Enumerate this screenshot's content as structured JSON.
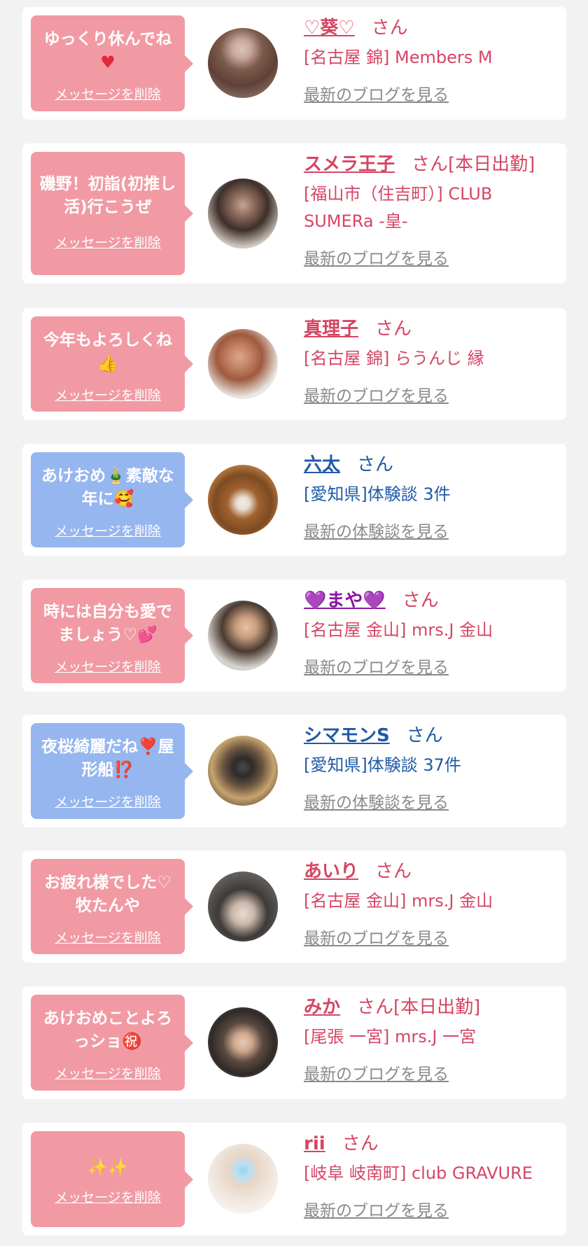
{
  "cards": [
    {
      "message": "ゆっくり休んでね",
      "message_emoji": "♥",
      "delete_label": "メッセージを削除",
      "name": "♡葵♡",
      "honorific": "さん",
      "shop": "[名古屋 錦] Members M",
      "link_label": "最新のブログを見る"
    },
    {
      "message": "磯野！初詣(初推し活)行こうぜ",
      "delete_label": "メッセージを削除",
      "name": "スメラ王子",
      "honorific": "さん[本日出勤]",
      "shop": "[福山市（住吉町）] CLUB SUMERa -皇-",
      "link_label": "最新のブログを見る"
    },
    {
      "message": "今年もよろしくね",
      "message_emoji": "👍",
      "delete_label": "メッセージを削除",
      "name": "真理子",
      "honorific": "さん",
      "shop": "[名古屋 錦] らうんじ 縁",
      "link_label": "最新のブログを見る"
    },
    {
      "message": "あけおめ🎍素敵な年に🥰",
      "delete_label": "メッセージを削除",
      "name": "六太",
      "honorific": "さん",
      "shop": "[愛知県]体験談 3件",
      "link_label": "最新の体験談を見る"
    },
    {
      "message": "時には自分も愛でましょう♡💕",
      "delete_label": "メッセージを削除",
      "name": "💜まや💜",
      "honorific": "さん",
      "shop": "[名古屋 金山] mrs.J 金山",
      "link_label": "最新のブログを見る"
    },
    {
      "message": "夜桜綺麗だね❣️屋形船⁉️",
      "delete_label": "メッセージを削除",
      "name": "シマモンS",
      "honorific": "さん",
      "shop": "[愛知県]体験談 37件",
      "link_label": "最新の体験談を見る"
    },
    {
      "message": "お疲れ様でした♡牧たんや",
      "delete_label": "メッセージを削除",
      "name": "あいり",
      "honorific": "さん",
      "shop": "[名古屋 金山] mrs.J 金山",
      "link_label": "最新のブログを見る"
    },
    {
      "message": "あけおめことよろっショ㊗️",
      "delete_label": "メッセージを削除",
      "name": "みか",
      "honorific": "さん[本日出勤]",
      "shop": "[尾張 一宮] mrs.J 一宮",
      "link_label": "最新のブログを見る"
    },
    {
      "message": "✨✨",
      "delete_label": "メッセージを削除",
      "name": "rii",
      "honorific": "さん",
      "shop": "[岐阜 岐南町] club GRAVURE",
      "link_label": "最新のブログを見る"
    }
  ],
  "colors": {
    "background": "#f2f2f2",
    "card": "#ffffff",
    "bubble_pink": "#f19aa4",
    "bubble_blue": "#96b6ef",
    "name_pink": "#d64564",
    "name_blue": "#1f5aa7",
    "name_purple": "#8a15a3",
    "link_gray": "#8a8a8a"
  }
}
